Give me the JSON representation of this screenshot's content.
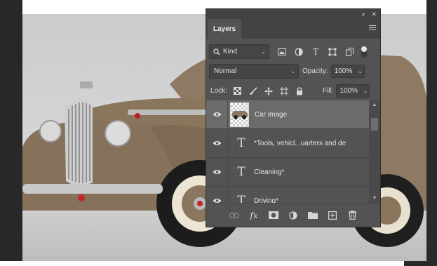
{
  "panel": {
    "collapse_glyph": "«",
    "close_glyph": "✕",
    "tab_label": "Layers",
    "filter": {
      "kind_label": "Kind",
      "filter_icons": [
        "image-filter-icon",
        "adjustment-filter-icon",
        "type-filter-icon",
        "shape-filter-icon",
        "smart-object-filter-icon",
        "filter-toggle-icon"
      ]
    },
    "blend_mode": "Normal",
    "opacity_label": "Opacity:",
    "opacity_value": "100%",
    "lock_label": "Lock:",
    "fill_label": "Fill:",
    "fill_value": "100%",
    "layers": [
      {
        "name": "Car image",
        "type": "image",
        "visible": true,
        "selected": true
      },
      {
        "name": "*Tools, vehicl...uarters and de",
        "type": "text",
        "visible": true,
        "selected": false
      },
      {
        "name": "Cleaning*",
        "type": "text",
        "visible": true,
        "selected": false
      },
      {
        "name": "Driving*",
        "type": "text",
        "visible": true,
        "selected": false
      }
    ],
    "type_glyph": "T",
    "bottom_icons": [
      "link-layers-icon",
      "fx-icon",
      "layer-mask-icon",
      "adjustment-layer-icon",
      "new-group-icon",
      "new-layer-icon",
      "delete-layer-icon"
    ],
    "fx_label": "fx"
  },
  "colors": {
    "panel_bg": "#535353",
    "panel_header": "#434343",
    "selected_row": "#6b6b6b",
    "car_body": "#8b7760"
  }
}
